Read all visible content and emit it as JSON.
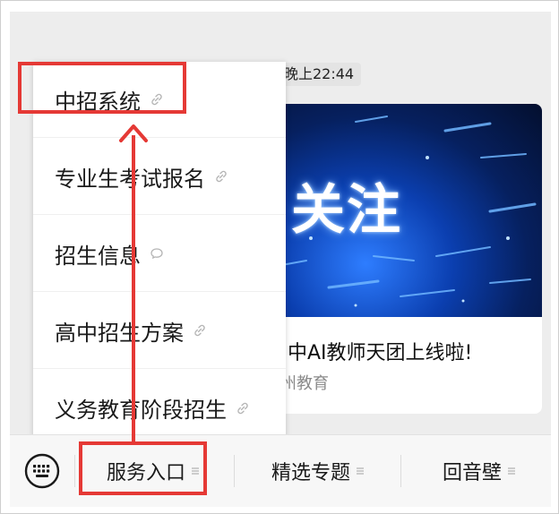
{
  "chat": {
    "timestamp": "晚上22:44",
    "card": {
      "banner_text": "关注",
      "title": "中AI教师天团上线啦!",
      "source": "州教育"
    }
  },
  "menu": {
    "items": [
      {
        "label": "中招系统",
        "icon": "link-icon"
      },
      {
        "label": "专业生考试报名",
        "icon": "link-icon"
      },
      {
        "label": "招生信息",
        "icon": "chat-bubble-icon"
      },
      {
        "label": "高中招生方案",
        "icon": "link-icon"
      },
      {
        "label": "义务教育阶段招生",
        "icon": "link-icon"
      }
    ]
  },
  "bottom_bar": {
    "keyboard_icon": "keyboard-icon",
    "tabs": [
      {
        "label": "服务入口",
        "icon": "menu-lines-icon"
      },
      {
        "label": "精选专题",
        "icon": "menu-lines-icon"
      },
      {
        "label": "回音壁",
        "icon": "menu-lines-icon"
      }
    ]
  },
  "colors": {
    "highlight": "#e53935",
    "chat_background": "#ededed",
    "banner_blue": "#0b3fb0"
  }
}
